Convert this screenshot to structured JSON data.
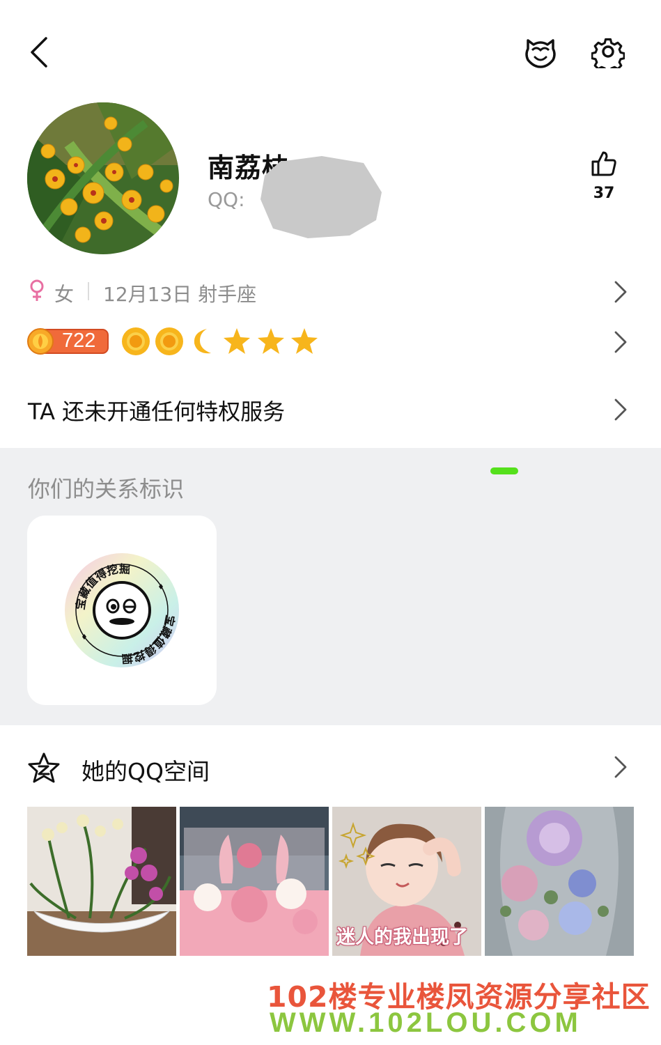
{
  "header": {
    "back_icon": "chevron-left-icon",
    "pet_icon": "pet-face-icon",
    "settings_icon": "gear-icon"
  },
  "profile": {
    "nickname": "南荔枝",
    "qq_label": "QQ:",
    "likes": "37",
    "like_icon": "thumbs-up-icon"
  },
  "info": {
    "gender": "女",
    "birthday": "12月13日 射手座",
    "gender_color": "#e86fa2"
  },
  "level": {
    "value": "722",
    "icons": [
      "sun-icon",
      "sun-icon",
      "moon-icon",
      "star-icon",
      "star-icon",
      "star-icon"
    ]
  },
  "privilege": {
    "text": "TA 还未开通任何特权服务"
  },
  "relation": {
    "title": "你们的关系标识",
    "badge_ring_text": "宝藏值得挖掘"
  },
  "qzone": {
    "title": "她的QQ空间",
    "photos": [
      {
        "name": "orchid-planter-photo",
        "caption": ""
      },
      {
        "name": "pink-flower-box-photo",
        "caption": ""
      },
      {
        "name": "child-photo",
        "caption": "迷人的我出现了"
      },
      {
        "name": "preserved-rose-photo",
        "caption": ""
      }
    ]
  },
  "watermark": {
    "line1": "102楼专业楼凤资源分享社区",
    "line2": "WWW.102LOU.COM"
  },
  "colors": {
    "background": "#ffffff",
    "section_bg": "#eff0f2",
    "secondary_text": "#8c8c8c",
    "level_badge": "#f06a3a",
    "star_yellow": "#f7b51c",
    "watermark_red": "#e9553b",
    "watermark_green": "#8cc63f"
  }
}
